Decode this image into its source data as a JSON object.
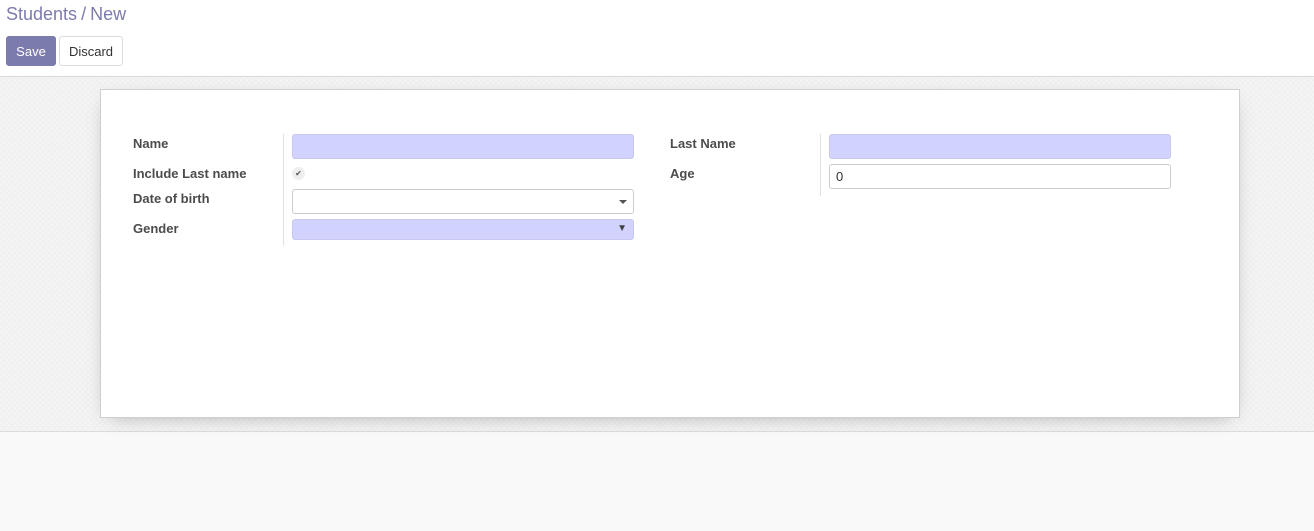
{
  "breadcrumb": {
    "parent": "Students",
    "separator": "/",
    "current": "New"
  },
  "toolbar": {
    "save_label": "Save",
    "discard_label": "Discard"
  },
  "form": {
    "left": {
      "name_label": "Name",
      "name_value": "",
      "include_last_name_label": "Include Last name",
      "include_last_name_checked": true,
      "checkbox_glyph": "✔",
      "dob_label": "Date of birth",
      "dob_value": "",
      "gender_label": "Gender",
      "gender_value": "",
      "gender_arrow": "▼"
    },
    "right": {
      "last_name_label": "Last Name",
      "last_name_value": "",
      "age_label": "Age",
      "age_value": "0"
    }
  },
  "colors": {
    "accent": "#7c7bad",
    "required_field": "#d2d2ff"
  },
  "icons": {
    "dropdown": "chevron-down-icon",
    "checkbox": "check-icon"
  }
}
